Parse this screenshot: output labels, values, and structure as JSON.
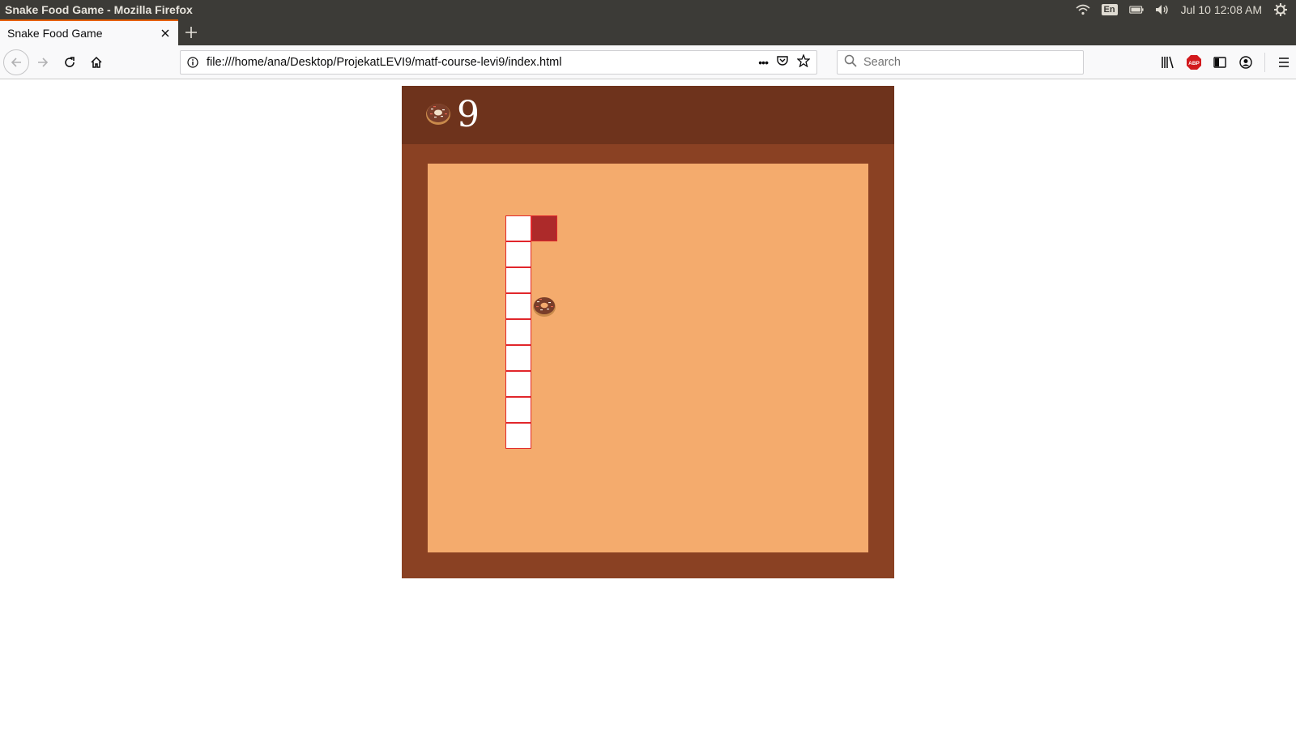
{
  "window": {
    "title": "Snake Food Game - Mozilla Firefox",
    "tray": {
      "lang": "En",
      "datetime": "Jul 10 12:08 AM"
    }
  },
  "tabs": [
    {
      "label": "Snake Food Game",
      "active": true
    }
  ],
  "nav": {
    "url": "file:///home/ana/Desktop/ProjekatLEVI9/matf-course-levi9/index.html",
    "search_placeholder": "Search",
    "url_actions": "•••"
  },
  "game": {
    "score": "9",
    "colors": {
      "frame": "#8a4123",
      "header": "#6e331c",
      "board": "#f4ab6d",
      "snake_body": "#ffffff",
      "snake_head": "#ad2a2a",
      "snake_border": "#e1262b"
    },
    "grid": {
      "cols": 17,
      "rows": 15
    },
    "snake": [
      {
        "col": 4,
        "row": 2,
        "head": true
      },
      {
        "col": 3,
        "row": 2
      },
      {
        "col": 3,
        "row": 3
      },
      {
        "col": 3,
        "row": 4
      },
      {
        "col": 3,
        "row": 5
      },
      {
        "col": 3,
        "row": 6
      },
      {
        "col": 3,
        "row": 7
      },
      {
        "col": 3,
        "row": 8
      },
      {
        "col": 3,
        "row": 9
      },
      {
        "col": 3,
        "row": 10
      }
    ],
    "food": {
      "col": 4,
      "row": 5,
      "icon": "donut-icon"
    }
  }
}
